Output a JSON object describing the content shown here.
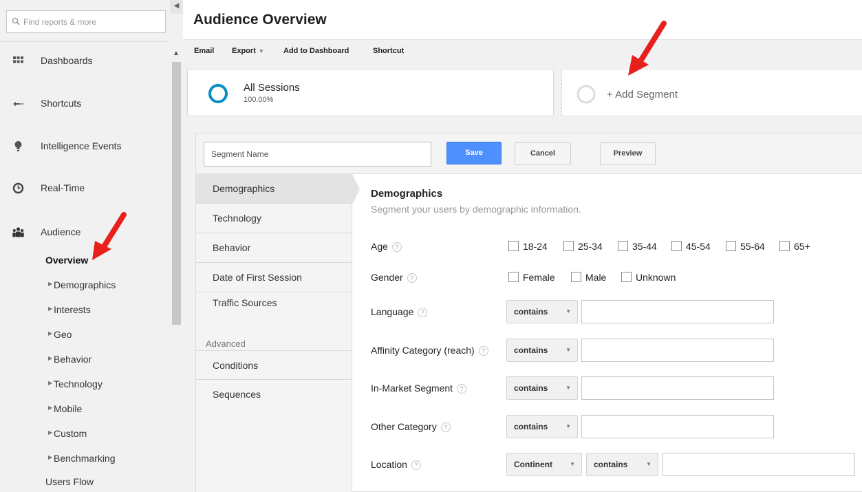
{
  "nav": {
    "search_placeholder": "Find reports & more",
    "items": [
      {
        "label": "Dashboards",
        "icon": "grid-icon"
      },
      {
        "label": "Shortcuts",
        "icon": "shortcut-arrow-icon"
      },
      {
        "label": "Intelligence Events",
        "icon": "lightbulb-icon"
      },
      {
        "label": "Real-Time",
        "icon": "clock-icon"
      },
      {
        "label": "Audience",
        "icon": "people-icon"
      }
    ],
    "audience_sub": [
      {
        "label": "Overview",
        "active": true
      },
      {
        "label": "Demographics"
      },
      {
        "label": "Interests"
      },
      {
        "label": "Geo"
      },
      {
        "label": "Behavior"
      },
      {
        "label": "Technology"
      },
      {
        "label": "Mobile"
      },
      {
        "label": "Custom"
      },
      {
        "label": "Benchmarking"
      },
      {
        "label": "Users Flow"
      }
    ]
  },
  "page": {
    "title": "Audience Overview"
  },
  "toolbar": {
    "email": "Email",
    "export": "Export",
    "add_dashboard": "Add to Dashboard",
    "shortcut": "Shortcut"
  },
  "segments": {
    "all_name": "All Sessions",
    "all_pct": "100.00%",
    "add_label": "+ Add Segment"
  },
  "editor": {
    "name_placeholder": "Segment Name",
    "save": "Save",
    "cancel": "Cancel",
    "preview": "Preview",
    "tabs": [
      "Demographics",
      "Technology",
      "Behavior",
      "Date of First Session",
      "Traffic Sources"
    ],
    "advanced_label": "Advanced",
    "advanced_tabs": [
      "Conditions",
      "Sequences"
    ],
    "section_title": "Demographics",
    "section_sub": "Segment your users by demographic information.",
    "age_label": "Age",
    "age_options": [
      "18-24",
      "25-34",
      "35-44",
      "45-54",
      "55-64",
      "65+"
    ],
    "gender_label": "Gender",
    "gender_options": [
      "Female",
      "Male",
      "Unknown"
    ],
    "language_label": "Language",
    "affinity_label": "Affinity Category (reach)",
    "inmarket_label": "In-Market Segment",
    "other_label": "Other Category",
    "location_label": "Location",
    "op_contains": "contains",
    "op_continent": "Continent",
    "help_glyph": "?"
  },
  "colors": {
    "accent_blue": "#4d90fe",
    "ring_blue": "#058dc7",
    "annotation_red": "#e8201c"
  }
}
